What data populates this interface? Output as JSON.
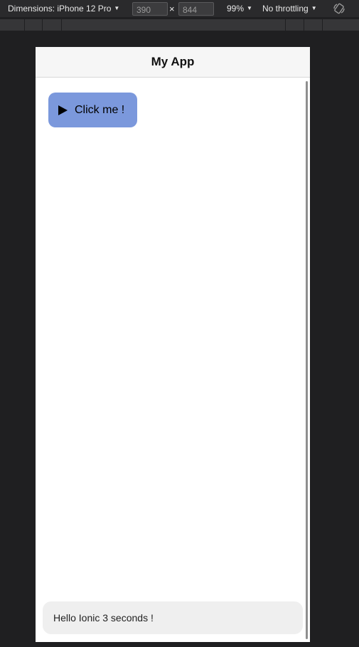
{
  "devtools": {
    "dimensions_label": "Dimensions: iPhone 12 Pro",
    "width_value": "390",
    "times": "×",
    "height_value": "844",
    "zoom": "99%",
    "throttling": "No throttling",
    "caret_icon": "caret-down-icon",
    "rotate_icon": "rotate-icon"
  },
  "app": {
    "title": "My App",
    "button_label": "Click me !",
    "button_icon": "play-icon",
    "button_color": "#7b98dc",
    "toast_message": "Hello Ionic 3 seconds !"
  }
}
